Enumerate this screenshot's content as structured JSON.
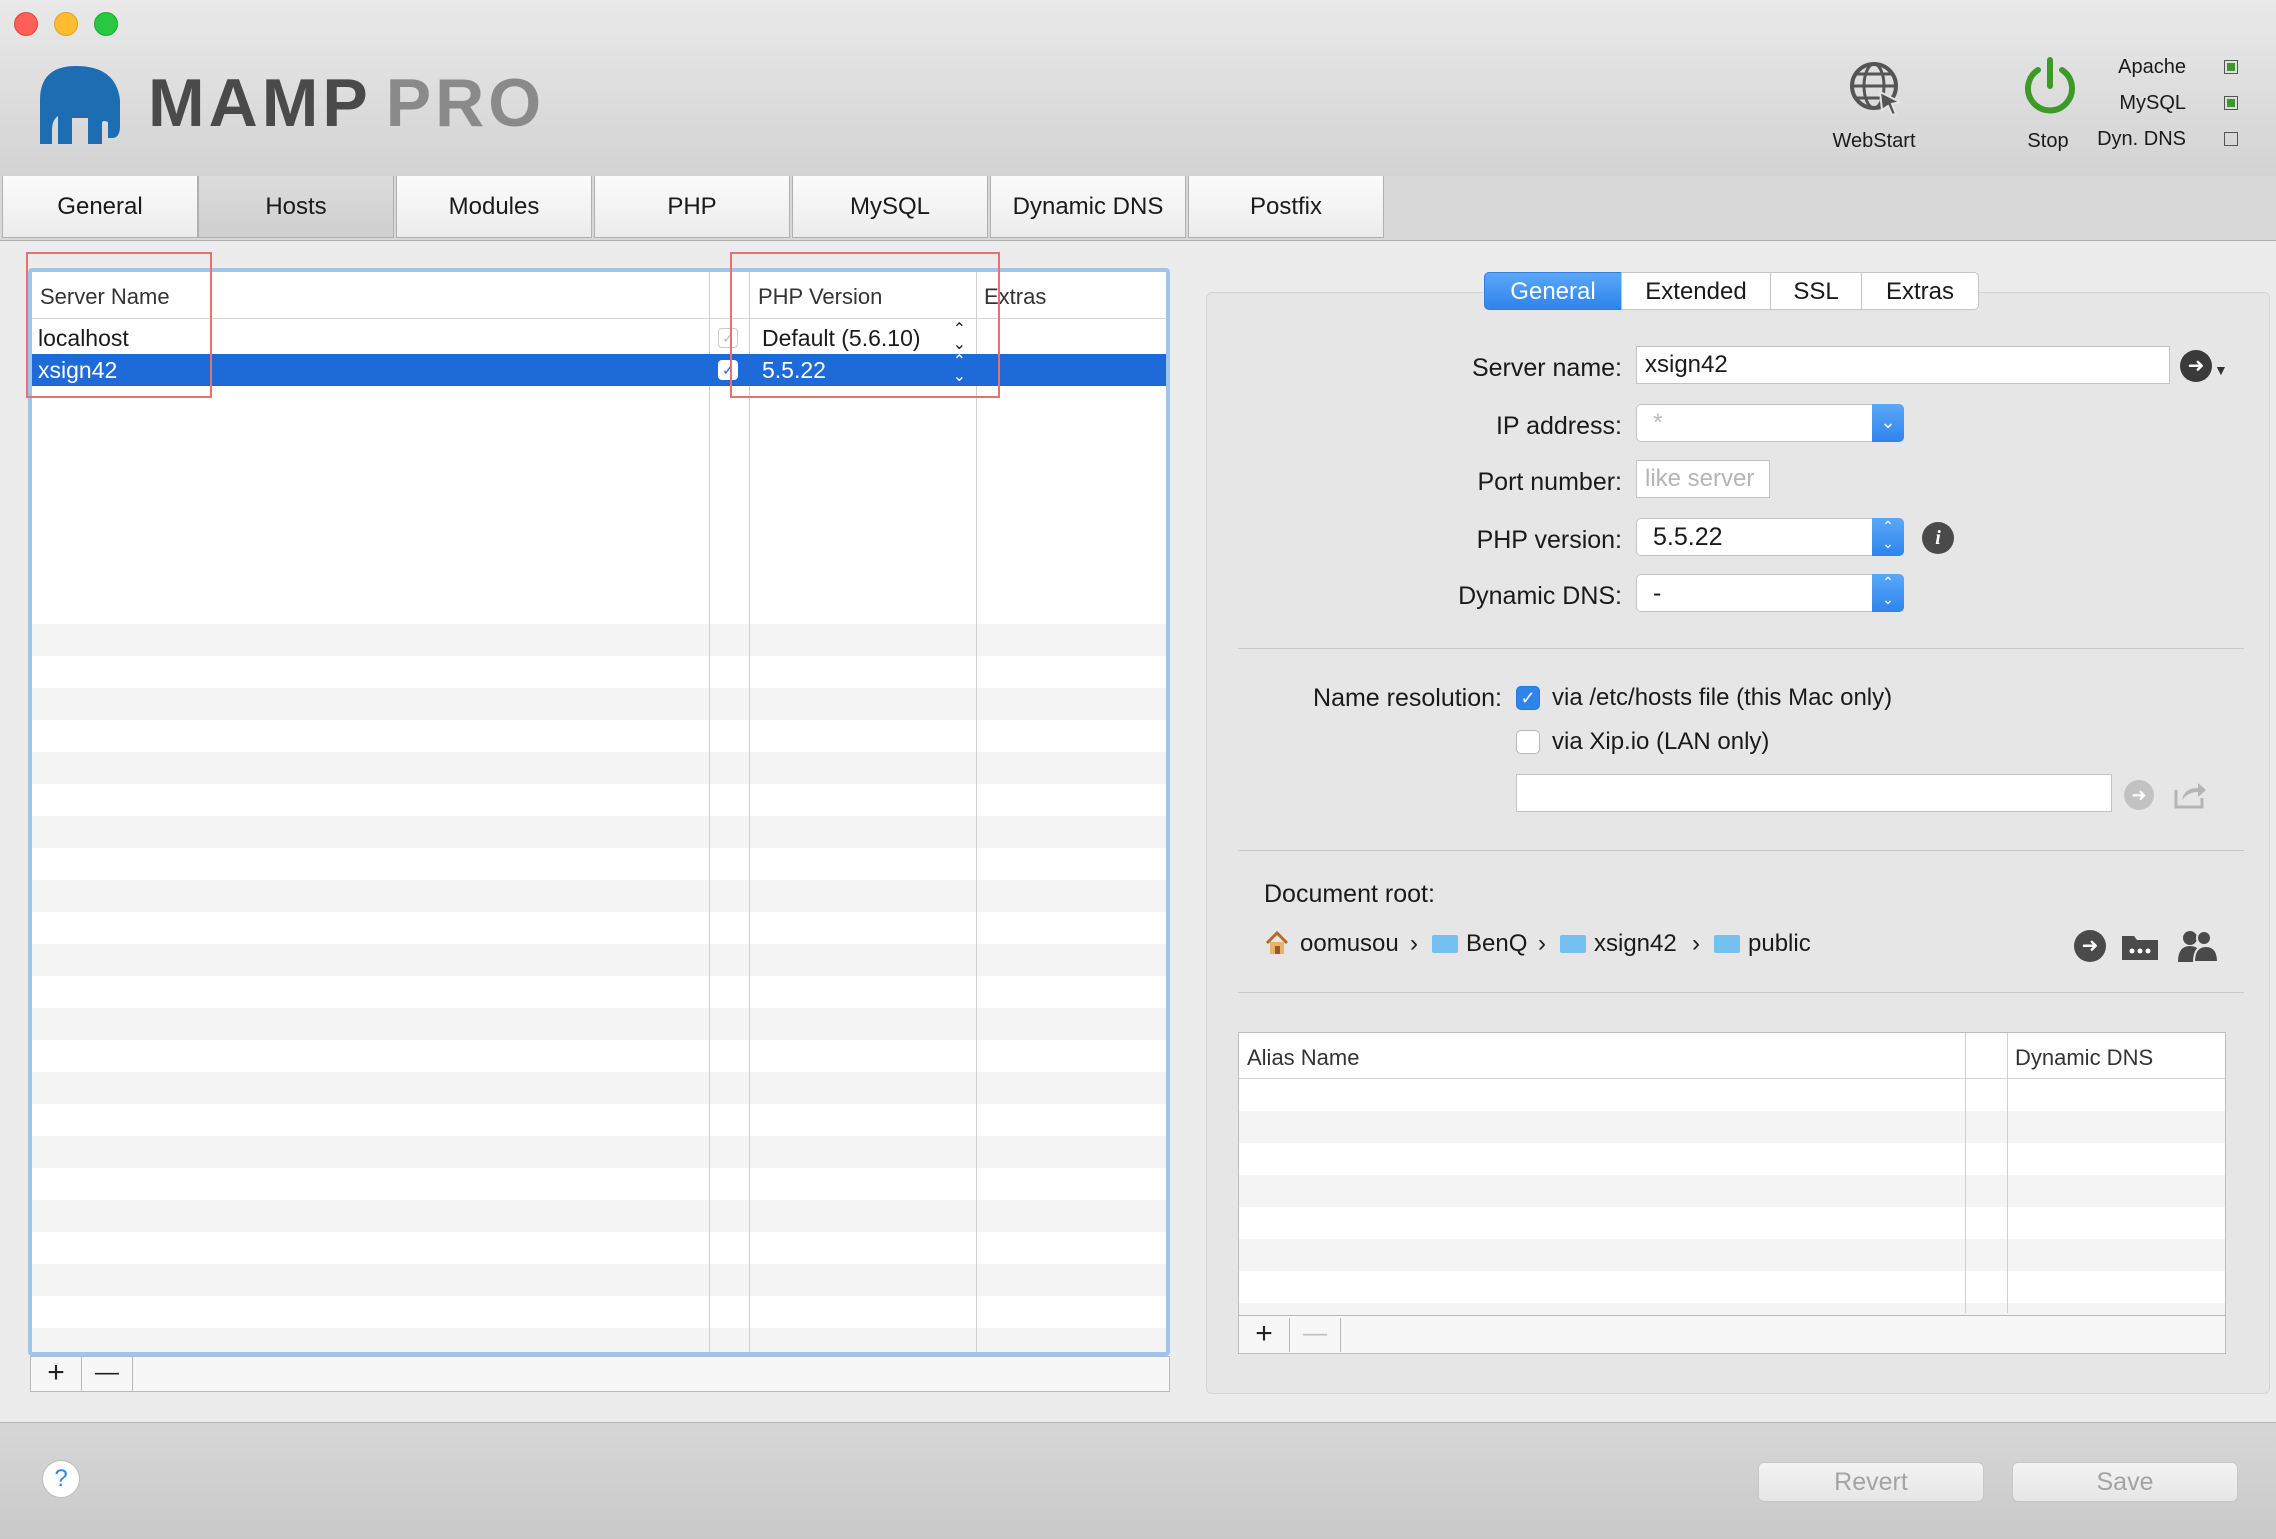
{
  "app": {
    "logo_main": "MAMP",
    "logo_pro": "PRO"
  },
  "toolbar": {
    "webstart_label": "WebStart",
    "stop_label": "Stop",
    "status": [
      {
        "label": "Apache",
        "active": true
      },
      {
        "label": "MySQL",
        "active": true
      },
      {
        "label": "Dyn. DNS",
        "active": false
      }
    ]
  },
  "tabs": [
    {
      "label": "General"
    },
    {
      "label": "Hosts",
      "active": true
    },
    {
      "label": "Modules"
    },
    {
      "label": "PHP"
    },
    {
      "label": "MySQL"
    },
    {
      "label": "Dynamic DNS"
    },
    {
      "label": "Postfix"
    }
  ],
  "hosts_table": {
    "columns": {
      "server_name": "Server Name",
      "php_version": "PHP Version",
      "extras": "Extras"
    },
    "rows": [
      {
        "server_name": "localhost",
        "php_version": "Default (5.6.10)",
        "selected": false
      },
      {
        "server_name": "xsign42",
        "php_version": "5.5.22",
        "selected": true
      }
    ],
    "add_label": "+",
    "remove_label": "—"
  },
  "detail_tabs": [
    {
      "label": "General",
      "active": true
    },
    {
      "label": "Extended"
    },
    {
      "label": "SSL"
    },
    {
      "label": "Extras"
    }
  ],
  "form": {
    "server_name_label": "Server name:",
    "server_name_value": "xsign42",
    "ip_address_label": "IP address:",
    "ip_address_value": "*",
    "port_number_label": "Port number:",
    "port_number_placeholder": "like server",
    "php_version_label": "PHP version:",
    "php_version_value": "5.5.22",
    "dynamic_dns_label": "Dynamic DNS:",
    "dynamic_dns_value": "-",
    "name_resolution_label": "Name resolution:",
    "hosts_file_label": "via /etc/hosts file (this Mac only)",
    "hosts_file_checked": true,
    "xip_label": "via Xip.io (LAN only)",
    "xip_checked": false,
    "xip_url_value": "",
    "document_root_label": "Document root:",
    "document_root_path": [
      "oomusou",
      "BenQ",
      "xsign42",
      "public"
    ],
    "path_separator": "›"
  },
  "alias_table": {
    "columns": {
      "alias_name": "Alias Name",
      "dynamic_dns": "Dynamic DNS"
    },
    "add_label": "+",
    "remove_label": "—"
  },
  "footer": {
    "help_label": "?",
    "revert_label": "Revert",
    "save_label": "Save"
  },
  "colors": {
    "accent": "#2f84ec",
    "selection": "#1f6ad9",
    "annotation": "#e8706e",
    "focus_ring": "#9fc4ee"
  }
}
